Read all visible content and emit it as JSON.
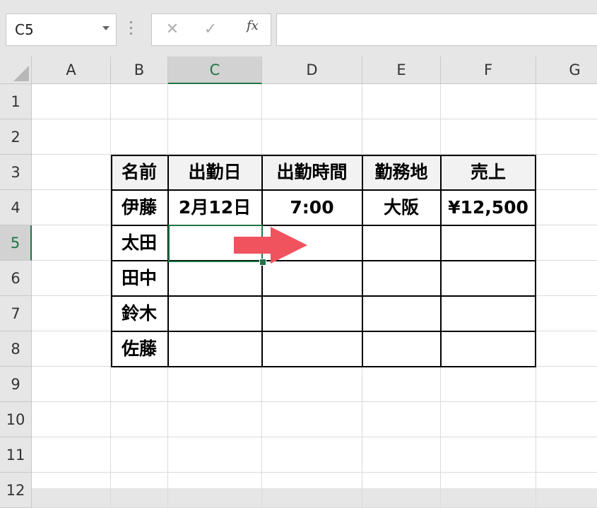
{
  "name_box": {
    "value": "C5"
  },
  "formula_bar": {
    "cancel_glyph": "✕",
    "enter_glyph": "✓",
    "fx_label": "fx",
    "value": ""
  },
  "columns": [
    "A",
    "B",
    "C",
    "D",
    "E",
    "F",
    "G"
  ],
  "rows": [
    "1",
    "2",
    "3",
    "4",
    "5",
    "6",
    "7",
    "8",
    "9",
    "10",
    "11",
    "12"
  ],
  "selected_cell": {
    "column": "C",
    "row": "5"
  },
  "table": {
    "headers": {
      "name": "名前",
      "date": "出勤日",
      "time": "出勤時間",
      "location": "勤務地",
      "sales": "売上"
    },
    "rows": [
      {
        "name": "伊藤",
        "date": "2月12日",
        "time": "7:00",
        "location": "大阪",
        "sales": "¥12,500"
      },
      {
        "name": "太田",
        "date": "",
        "time": "",
        "location": "",
        "sales": ""
      },
      {
        "name": "田中",
        "date": "",
        "time": "",
        "location": "",
        "sales": ""
      },
      {
        "name": "鈴木",
        "date": "",
        "time": "",
        "location": "",
        "sales": ""
      },
      {
        "name": "佐藤",
        "date": "",
        "time": "",
        "location": "",
        "sales": ""
      }
    ]
  },
  "colors": {
    "selection": "#217346",
    "arrow": "#f0525e",
    "header_fill": "#f2f2f2"
  }
}
